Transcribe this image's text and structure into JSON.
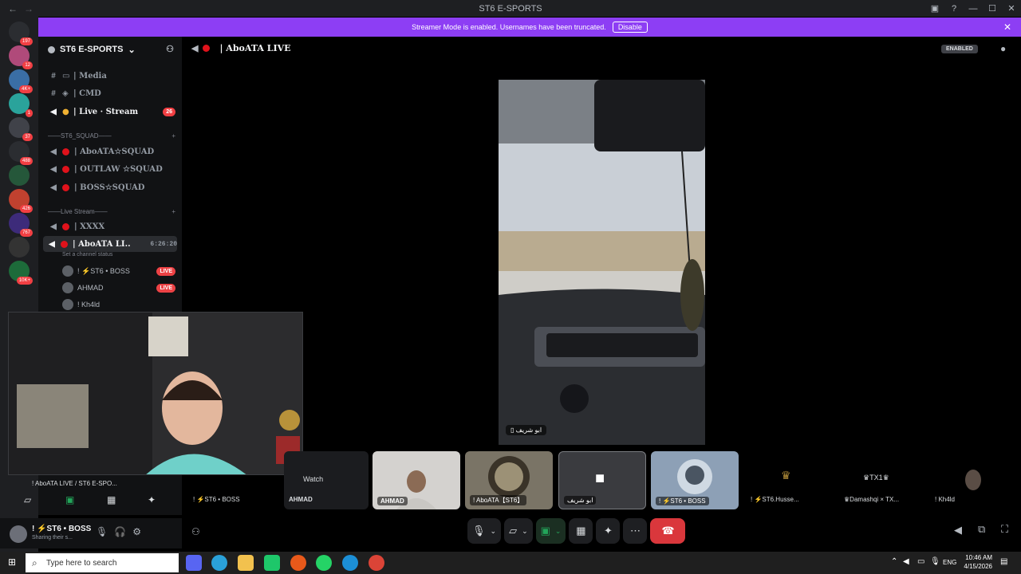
{
  "window": {
    "title": "ST6 E-SPORTS"
  },
  "banner": {
    "text": "Streamer Mode is enabled. Usernames have been truncated.",
    "button": "Disable"
  },
  "servers": [
    {
      "badge": "197",
      "color": "#2b2d31"
    },
    {
      "badge": "12",
      "color": "#b04a7a"
    },
    {
      "badge": "4K+",
      "color": "#3a6ea5"
    },
    {
      "badge": "1",
      "color": "#2aa39b"
    },
    {
      "badge": "37",
      "color": "#404249"
    },
    {
      "badge": "488",
      "color": "#2b2d31"
    },
    {
      "badge": "",
      "color": "#25573a"
    },
    {
      "badge": "426",
      "color": "#c0412f"
    },
    {
      "badge": "767",
      "color": "#3d2b7a"
    },
    {
      "badge": "",
      "color": "#333"
    },
    {
      "badge": "10K+",
      "color": "#1d6b3a"
    }
  ],
  "guild": {
    "name": "ST6 E-SPORTS"
  },
  "channels": {
    "media": "| Media",
    "cmd": "| CMD",
    "live_stream": "| Live · Stream",
    "live_stream_count": "26",
    "cat_squad": "——ST6_SQUAD——",
    "squad1": "| AboATA☆SQUAD",
    "squad2": "| OUTLAW ☆SQUAD",
    "squad3": "| BOSS☆SQUAD",
    "cat_live": "——Live Stream——",
    "xxxx": "| XXXX",
    "active": "| AboATA LI..",
    "active_timer": "6:26:20",
    "active_status": "Set a channel status",
    "users": [
      {
        "name": "! ⚡ST6 • BOSS",
        "live": "LIVE"
      },
      {
        "name": "AHMAD",
        "live": "LIVE"
      },
      {
        "name": "! Kh4ld",
        "live": ""
      }
    ]
  },
  "topbar": {
    "channel": "| AboATA LIVE",
    "enabled": "ENABLED"
  },
  "stream": {
    "label": "ابو شريف"
  },
  "webcam_overlay": {
    "title": "! AboATA LIVE / ST6 E-SPO...",
    "watch": "Watch"
  },
  "tiles": [
    {
      "label": "! ⚡ST6 • BOSS"
    },
    {
      "label": "AHMAD"
    },
    {
      "label": "AHMAD"
    },
    {
      "label": "! AboATA【ST6】"
    },
    {
      "label": "ابو شريف"
    },
    {
      "label": "! ⚡ST6 • BOSS"
    },
    {
      "label": "! ⚡ST6.Husse..."
    },
    {
      "label": "♛Damashqi × TX..."
    },
    {
      "label": "! Kh4ld"
    }
  ],
  "tile_extra": {
    "tx1": "♛TX1♛"
  },
  "user": {
    "name": "! ⚡ST6 • BOSS",
    "status": "Sharing their s..."
  },
  "taskbar": {
    "search": "Type here to search",
    "lang": "ENG",
    "time": "10:46 AM",
    "date": "4/15/2026"
  }
}
